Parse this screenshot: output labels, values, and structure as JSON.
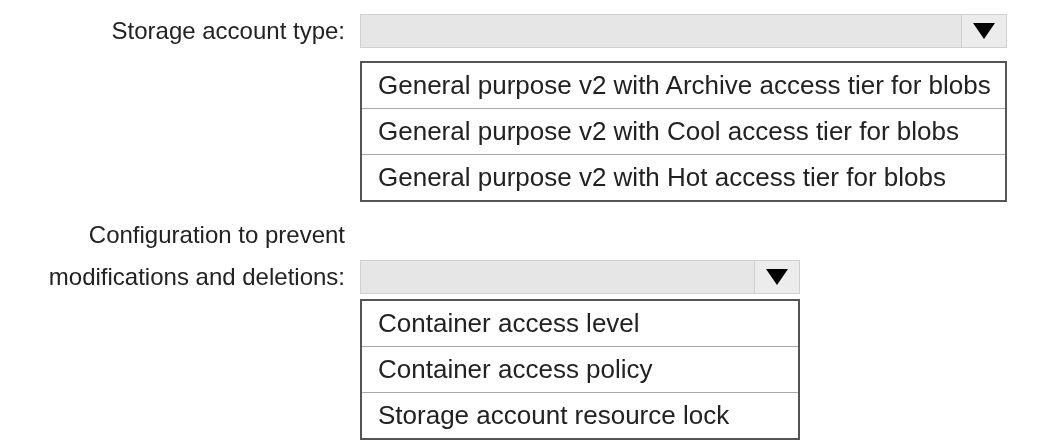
{
  "fields": [
    {
      "label": "Storage account type:",
      "options": [
        "General purpose v2 with Archive access tier for blobs",
        "General purpose v2 with Cool access tier for blobs",
        "General purpose v2 with Hot access tier for blobs"
      ]
    },
    {
      "label": "Configuration to prevent modifications and deletions:",
      "options": [
        "Container access level",
        "Container access policy",
        "Storage account resource lock"
      ]
    }
  ]
}
